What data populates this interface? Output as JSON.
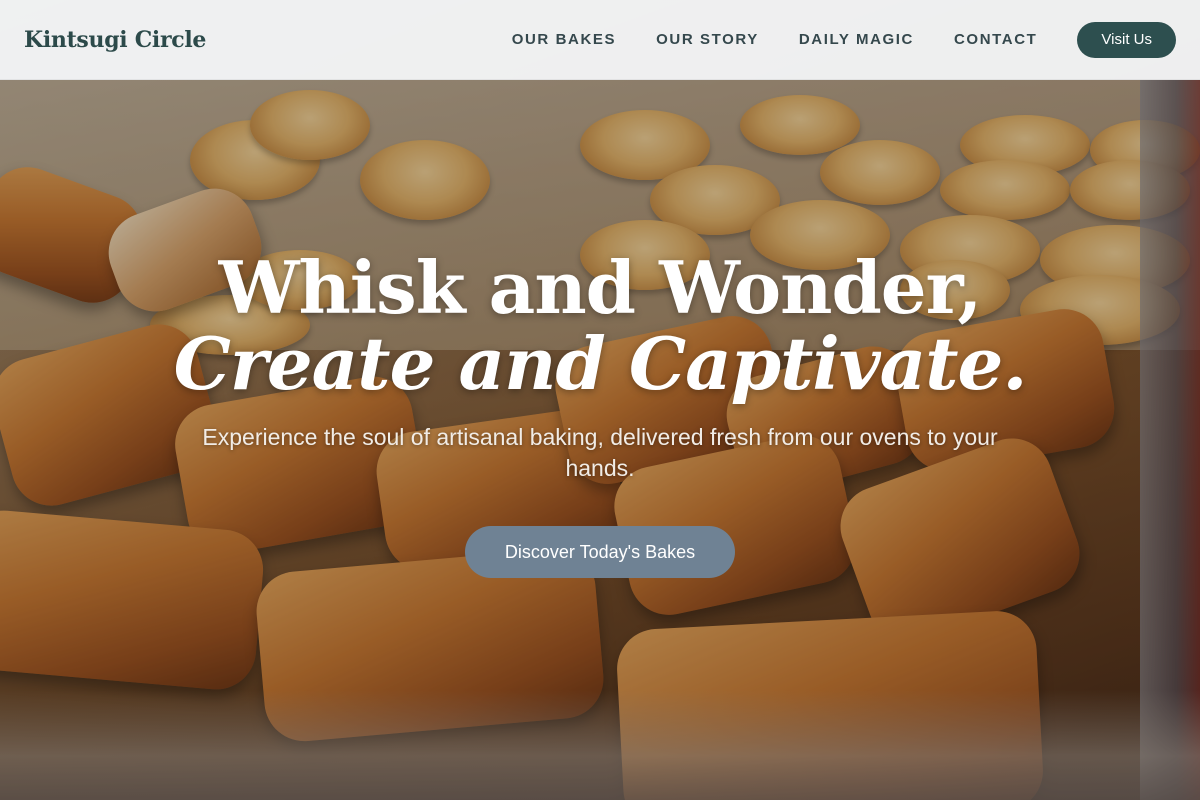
{
  "header": {
    "brand": "Kintsugi Circle",
    "nav": [
      "OUR BAKES",
      "OUR STORY",
      "DAILY MAGIC",
      "CONTACT"
    ],
    "visit_label": "Visit Us"
  },
  "hero": {
    "line1": "Whisk and Wonder,",
    "line2": "Create and Captivate.",
    "subtitle": "Experience the soul of artisanal baking, delivered fresh from our ovens to your hands.",
    "cta_label": "Discover Today's Bakes",
    "image": "bakery-pastries-photo"
  },
  "colors": {
    "header_bg": "#f7f9fb",
    "brand_text": "#2c4a4a",
    "visit_button": "#2d4f4f",
    "cta_button": "#6f8294",
    "hero_text": "#ffffff"
  }
}
